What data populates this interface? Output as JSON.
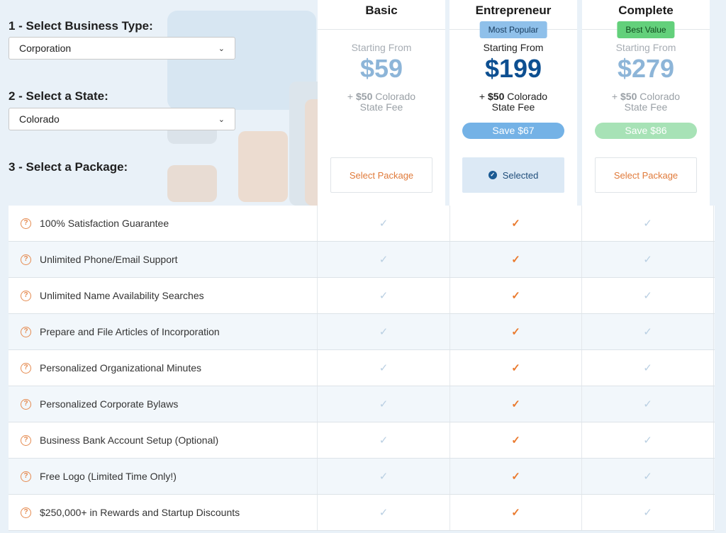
{
  "steps": {
    "business_type_label": "1 - Select Business Type:",
    "business_type_value": "Corporation",
    "state_label": "2 - Select a State:",
    "state_value": "Colorado",
    "package_label": "3 - Select a Package:"
  },
  "plans": [
    {
      "name": "Basic",
      "badge": "",
      "starting": "Starting From",
      "price": "$59",
      "fee_amount": "$50",
      "fee_text": "Colorado",
      "fee_text2": "State Fee",
      "save": "",
      "button": "Select Package"
    },
    {
      "name": "Entrepreneur",
      "badge": "Most Popular",
      "starting": "Starting From",
      "price": "$199",
      "fee_amount": "$50",
      "fee_text": "Colorado",
      "fee_text2": "State Fee",
      "save": "Save $67",
      "button": "Selected"
    },
    {
      "name": "Complete",
      "badge": "Best Value",
      "starting": "Starting From",
      "price": "$279",
      "fee_amount": "$50",
      "fee_text": "Colorado",
      "fee_text2": "State Fee",
      "save": "Save $86",
      "button": "Select Package"
    }
  ],
  "features": [
    "100% Satisfaction Guarantee",
    "Unlimited Phone/Email Support",
    "Unlimited Name Availability Searches",
    "Prepare and File Articles of Incorporation",
    "Personalized Organizational Minutes",
    "Personalized Corporate Bylaws",
    "Business Bank Account Setup (Optional)",
    "Free Logo (Limited Time Only!)",
    "$250,000+ in Rewards and Startup Discounts"
  ],
  "symbols": {
    "check": "✓",
    "question": "?",
    "plus": "+",
    "chevron": "⌄"
  },
  "colors": {
    "accent_orange": "#ea7a2e",
    "selected_blue": "#0d4f91",
    "badge_green": "#63d07b",
    "badge_blue": "#8fc0ea"
  }
}
